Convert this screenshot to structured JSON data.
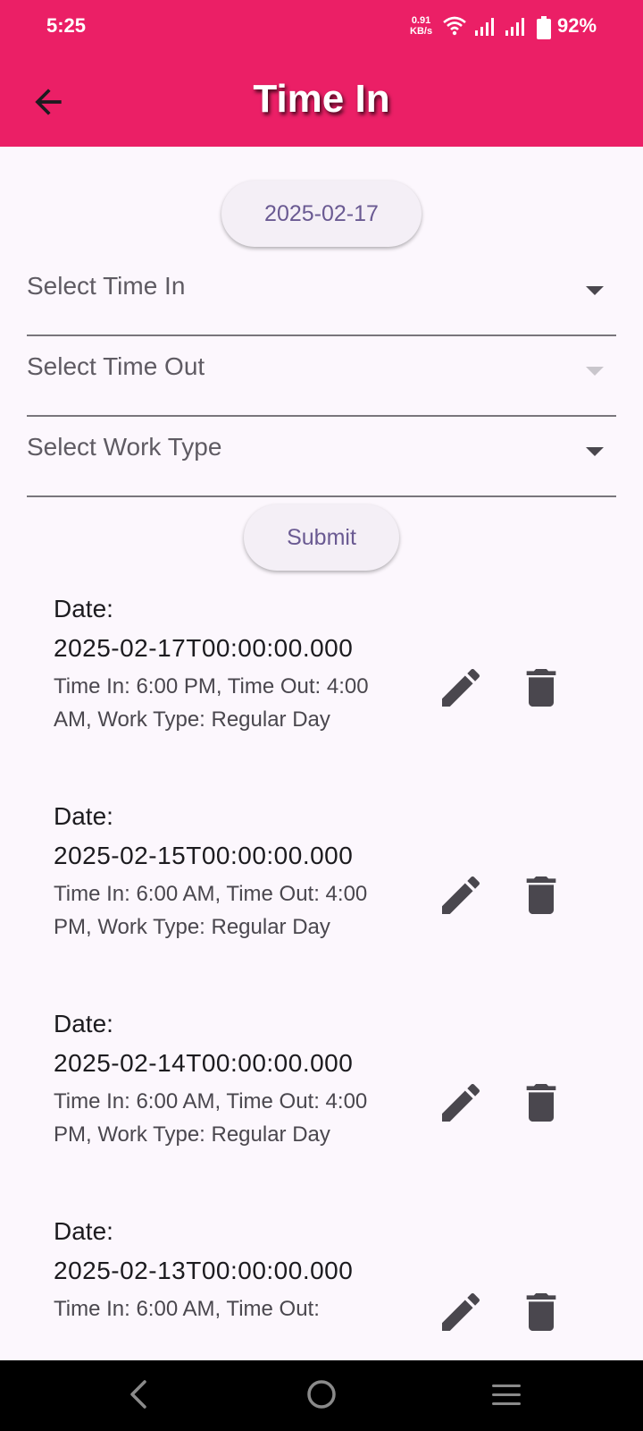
{
  "status_bar": {
    "time": "5:25",
    "net_speed_value": "0.91",
    "net_speed_unit": "KB/s",
    "battery": "92%"
  },
  "app_bar": {
    "title": "Time In",
    "color": "#eb1f66"
  },
  "form": {
    "date_button": "2025-02-17",
    "time_in_placeholder": "Select Time In",
    "time_out_placeholder": "Select Time Out",
    "work_type_placeholder": "Select Work Type",
    "submit_label": "Submit"
  },
  "entries": [
    {
      "date_label": "Date:",
      "date_value": "2025-02-17T00:00:00.000",
      "details": "Time In: 6:00 PM, Time Out: 4:00 AM, Work Type: Regular Day"
    },
    {
      "date_label": "Date:",
      "date_value": "2025-02-15T00:00:00.000",
      "details": "Time In: 6:00 AM, Time Out: 4:00 PM, Work Type: Regular Day"
    },
    {
      "date_label": "Date:",
      "date_value": "2025-02-14T00:00:00.000",
      "details": "Time In: 6:00 AM, Time Out: 4:00 PM, Work Type: Regular Day"
    },
    {
      "date_label": "Date:",
      "date_value": "2025-02-13T00:00:00.000",
      "details": "Time In: 6:00 AM, Time Out:"
    }
  ],
  "icons": {
    "back": "arrow-back-icon",
    "edit": "pencil-icon",
    "delete": "trash-icon",
    "dropdown": "caret-down-icon"
  }
}
